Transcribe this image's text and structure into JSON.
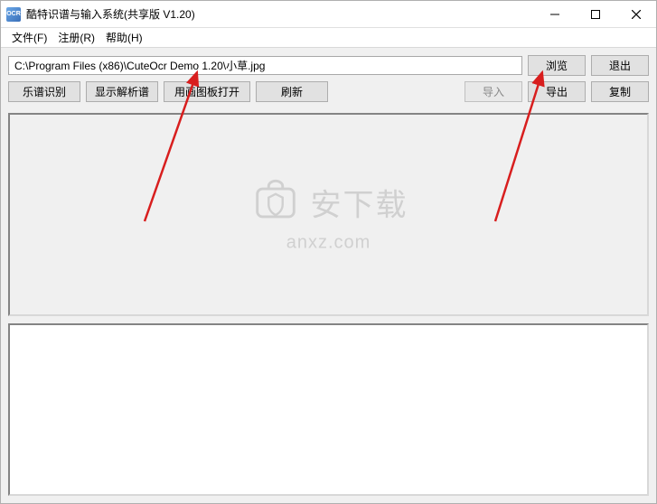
{
  "title": "酷特识谱与输入系统(共享版 V1.20)",
  "app_icon_label": "OCR",
  "menu": {
    "file": "文件(F)",
    "register": "注册(R)",
    "help": "帮助(H)"
  },
  "path_input": {
    "value": "C:\\Program Files (x86)\\CuteOcr Demo 1.20\\小草.jpg"
  },
  "buttons": {
    "browse": "浏览",
    "exit": "退出",
    "recognize": "乐谱识别",
    "show_parse": "显示解析谱",
    "open_paint": "用画图板打开",
    "refresh": "刷新",
    "import": "导入",
    "export": "导出",
    "copy": "复制"
  },
  "watermark": {
    "text": "安下载",
    "url": "anxz.com"
  }
}
